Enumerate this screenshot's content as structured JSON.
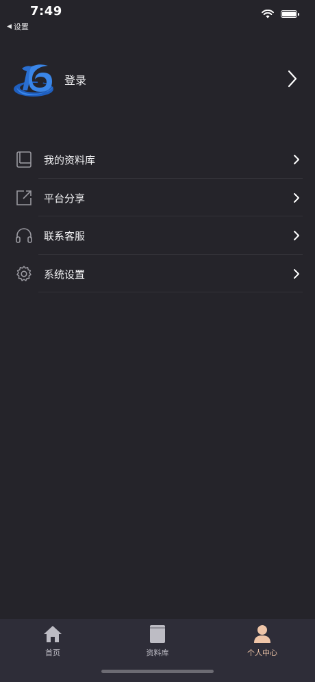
{
  "status_bar": {
    "time": "7:49",
    "back_label": "设置"
  },
  "profile": {
    "login_label": "登录"
  },
  "menu": {
    "items": [
      {
        "label": "我的资料库",
        "icon": "book-icon"
      },
      {
        "label": "平台分享",
        "icon": "share-icon"
      },
      {
        "label": "联系客服",
        "icon": "headphones-icon"
      },
      {
        "label": "系统设置",
        "icon": "gear-icon"
      }
    ]
  },
  "tabbar": {
    "tabs": [
      {
        "label": "首页",
        "icon": "home-icon"
      },
      {
        "label": "资料库",
        "icon": "book-icon"
      },
      {
        "label": "个人中心",
        "icon": "person-icon"
      }
    ],
    "active_index": 2,
    "active_color": "#efc5a8"
  },
  "colors": {
    "background": "#25242a",
    "tabbar": "#2e2d38",
    "logo_blue": "#2a6fd1"
  }
}
